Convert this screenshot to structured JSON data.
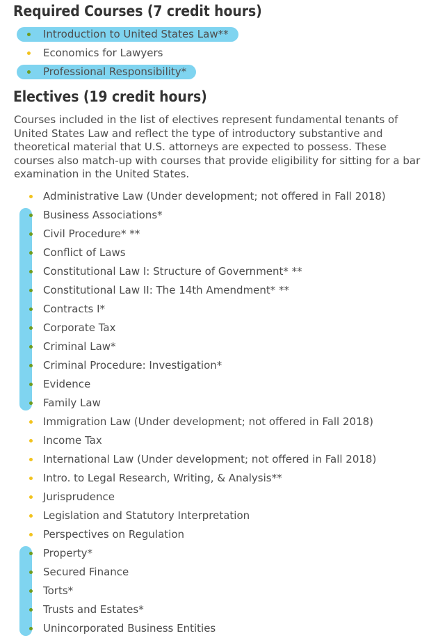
{
  "sections": {
    "required": {
      "heading": "Required Courses (7 credit hours)",
      "items": [
        {
          "label": "Introduction to United States Law**",
          "highlighted": true,
          "bullet": "green"
        },
        {
          "label": "Economics for Lawyers",
          "highlighted": false,
          "bullet": "yellow"
        },
        {
          "label": "Professional Responsibility*",
          "highlighted": true,
          "bullet": "green"
        }
      ]
    },
    "electives": {
      "heading": "Electives (19 credit hours)",
      "intro": "Courses included in the list of electives represent fundamental tenants of United States Law and reflect the type of introductory substantive and theoretical material that U.S. attorneys are expected to possess. These courses also match-up with courses that provide eligibility for sitting for a bar examination in the United States.",
      "items": [
        {
          "label": "Administrative Law (Under development; not offered in Fall 2018)",
          "highlighted": false,
          "bullet": "yellow"
        },
        {
          "label": "Business Associations*",
          "highlighted": true,
          "bullet": "green"
        },
        {
          "label": "Civil Procedure* **",
          "highlighted": true,
          "bullet": "green"
        },
        {
          "label": "Conflict of Laws",
          "highlighted": true,
          "bullet": "green"
        },
        {
          "label": "Constitutional Law I: Structure of Government* **",
          "highlighted": true,
          "bullet": "green"
        },
        {
          "label": "Constitutional Law II: The 14th Amendment* **",
          "highlighted": true,
          "bullet": "green"
        },
        {
          "label": "Contracts I*",
          "highlighted": true,
          "bullet": "green"
        },
        {
          "label": "Corporate Tax",
          "highlighted": true,
          "bullet": "green"
        },
        {
          "label": "Criminal Law*",
          "highlighted": true,
          "bullet": "green"
        },
        {
          "label": "Criminal Procedure: Investigation*",
          "highlighted": true,
          "bullet": "green"
        },
        {
          "label": "Evidence",
          "highlighted": true,
          "bullet": "green"
        },
        {
          "label": "Family Law",
          "highlighted": true,
          "bullet": "green"
        },
        {
          "label": "Immigration Law (Under development; not offered in Fall 2018)",
          "highlighted": false,
          "bullet": "yellow"
        },
        {
          "label": "Income Tax",
          "highlighted": false,
          "bullet": "yellow"
        },
        {
          "label": "International Law (Under development; not offered in Fall 2018)",
          "highlighted": false,
          "bullet": "yellow"
        },
        {
          "label": "Intro. to Legal Research, Writing, & Analysis**",
          "highlighted": false,
          "bullet": "yellow"
        },
        {
          "label": "Jurisprudence",
          "highlighted": false,
          "bullet": "yellow"
        },
        {
          "label": "Legislation and Statutory Interpretation",
          "highlighted": false,
          "bullet": "yellow"
        },
        {
          "label": "Perspectives on Regulation",
          "highlighted": false,
          "bullet": "yellow"
        },
        {
          "label": "Property*",
          "highlighted": true,
          "bullet": "green"
        },
        {
          "label": "Secured Finance",
          "highlighted": true,
          "bullet": "green"
        },
        {
          "label": "Torts*",
          "highlighted": true,
          "bullet": "green"
        },
        {
          "label": "Trusts and Estates*",
          "highlighted": true,
          "bullet": "green"
        },
        {
          "label": "Unincorporated Business Entities",
          "highlighted": true,
          "bullet": "green"
        }
      ]
    }
  },
  "colors": {
    "highlight": "#7fd4f0",
    "bullet_green": "#6f9c1e",
    "bullet_yellow": "#f2c31d",
    "heading_text": "#333333",
    "body_text": "#4d4d4d"
  }
}
